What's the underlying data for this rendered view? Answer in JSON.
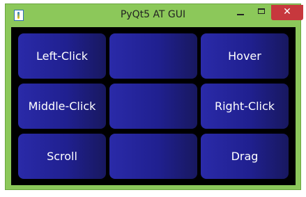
{
  "window": {
    "title": "PyQt5 AT GUI",
    "icons": {
      "app": "python-app-icon",
      "minimize": "minimize-icon",
      "maximize": "maximize-icon",
      "close": "close-icon"
    },
    "colors": {
      "frame": "#8cc85a",
      "client_bg": "#000000",
      "close_button": "#c7383d",
      "button_gradient_start": "#2a2aa8",
      "button_gradient_end": "#18185f"
    }
  },
  "grid": {
    "buttons": [
      {
        "label": "Left-Click"
      },
      {
        "label": ""
      },
      {
        "label": "Hover"
      },
      {
        "label": "Middle-Click"
      },
      {
        "label": ""
      },
      {
        "label": "Right-Click"
      },
      {
        "label": "Scroll"
      },
      {
        "label": ""
      },
      {
        "label": "Drag"
      }
    ]
  },
  "controls": {
    "close_glyph": "✕"
  }
}
